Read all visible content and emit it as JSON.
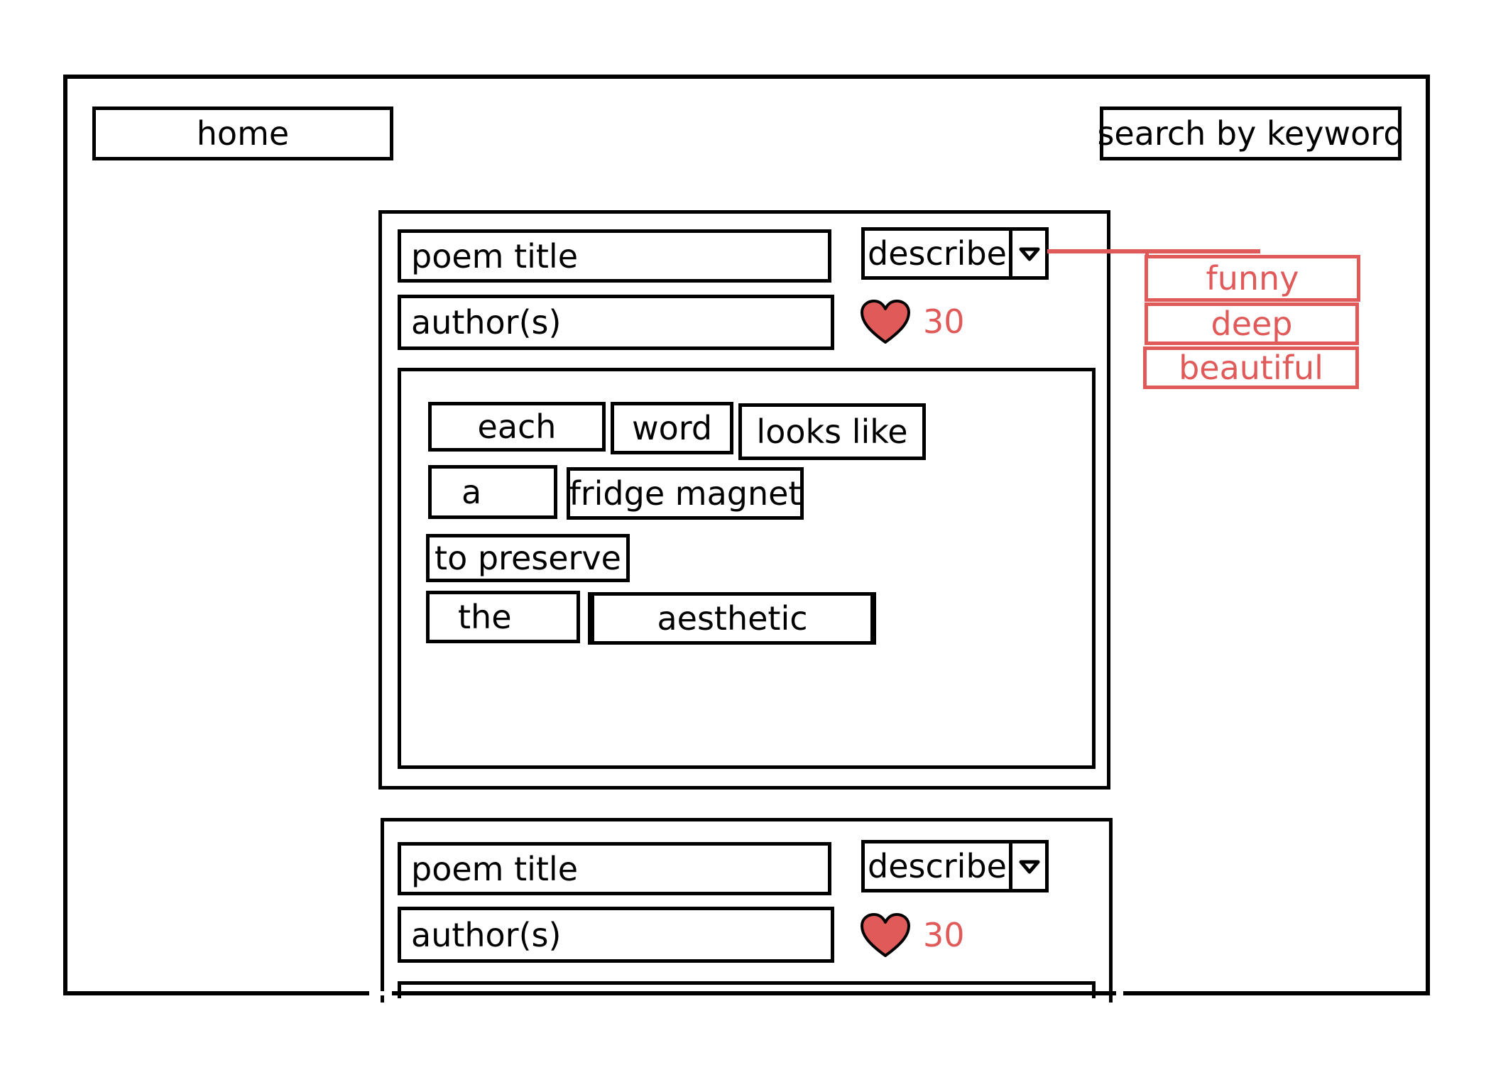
{
  "nav": {
    "home_label": "home",
    "search_label": "search by keyword"
  },
  "poems": [
    {
      "title": "poem title",
      "authors": "author(s)",
      "describe_label": "describe",
      "likes": "30",
      "words": [
        "each",
        "word",
        "looks like",
        "a",
        "fridge magnet",
        "to preserve",
        "the",
        "aesthetic"
      ]
    },
    {
      "title": "poem title",
      "authors": "author(s)",
      "describe_label": "describe",
      "likes": "30"
    }
  ],
  "describe_options": [
    "funny",
    "deep",
    "beautiful"
  ],
  "colors": {
    "accent": "#e15a5a",
    "outline": "#000000"
  }
}
